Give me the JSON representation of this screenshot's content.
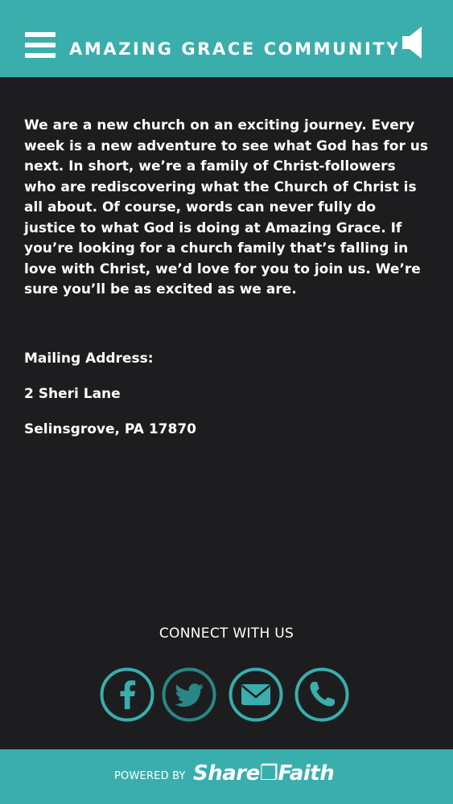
{
  "header": {
    "title": "AMAZING GRACE COMMUNITY C",
    "menu_icon": "hamburger-menu-icon",
    "audio_icon": "speaker-icon"
  },
  "main": {
    "intro": "We are a new church on an exciting journey. Every week is a new adventure to see what God has for us next. In short, we’re a family of Christ-followers who are rediscovering what the Church of Christ is all about. Of course, words can never fully do justice to what God is doing at Amazing Grace. If you’re looking for a church family that’s falling in love with Christ, we’d love for you to join us. We’re sure you’ll be as excited as we are.",
    "mailing_label": "Mailing Address:",
    "address_line1": "2 Sheri Lane",
    "address_line2": "Selinsgrove, PA 17870"
  },
  "connect": {
    "heading": "CONNECT WITH US",
    "icons": [
      "facebook-icon",
      "twitter-icon",
      "email-icon",
      "phone-icon"
    ]
  },
  "footer": {
    "powered_by": "POWERED BY",
    "brand": "Share❐Faith"
  },
  "colors": {
    "accent": "#39aead",
    "background": "#1d1d1f",
    "text": "#ffffff"
  }
}
